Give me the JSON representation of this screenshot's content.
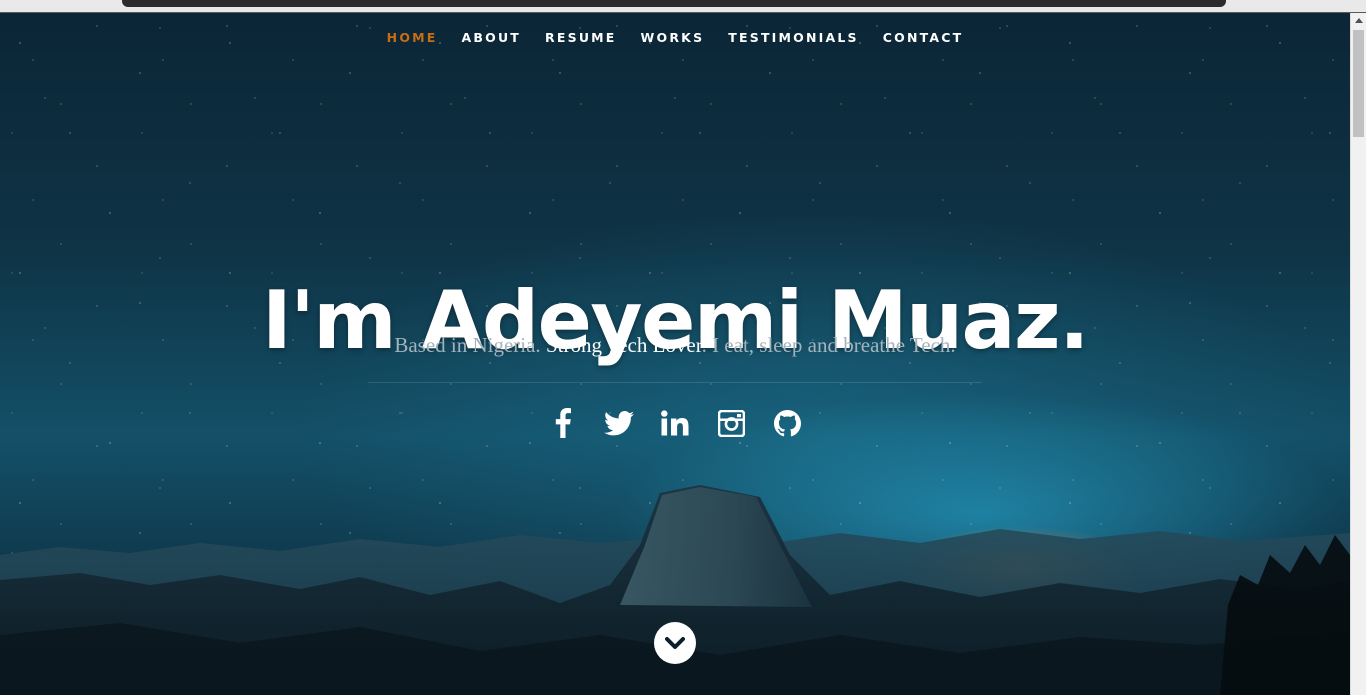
{
  "nav": {
    "items": [
      {
        "label": "HOME",
        "active": true
      },
      {
        "label": "ABOUT",
        "active": false
      },
      {
        "label": "RESUME",
        "active": false
      },
      {
        "label": "WORKS",
        "active": false
      },
      {
        "label": "TESTIMONIALS",
        "active": false
      },
      {
        "label": "CONTACT",
        "active": false
      }
    ],
    "active_color": "#c96d14"
  },
  "hero": {
    "headline": "I'm Adeyemi Muaz.",
    "tagline_part1": "Based in Nigeria. ",
    "tagline_strong": "Strong Tech Lover",
    "tagline_part2": ". I eat, sleep and breathe Tech."
  },
  "social": [
    {
      "icon": "facebook-icon"
    },
    {
      "icon": "twitter-icon"
    },
    {
      "icon": "linkedin-icon"
    },
    {
      "icon": "instagram-icon"
    },
    {
      "icon": "github-icon"
    }
  ],
  "scroll_down": {
    "icon": "chevron-down-icon"
  }
}
